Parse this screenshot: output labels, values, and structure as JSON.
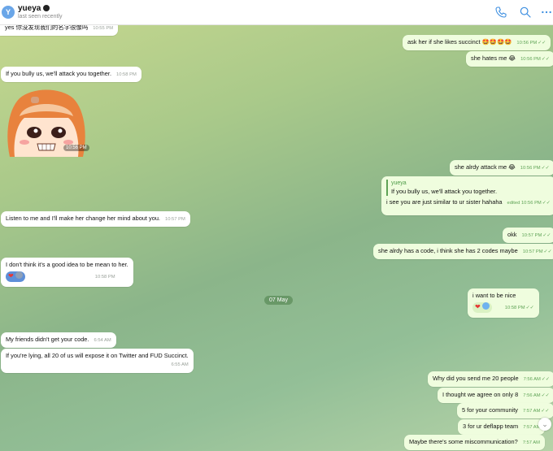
{
  "header": {
    "avatar_letter": "Y",
    "name": "yueya",
    "status": "last seen recently",
    "icons": [
      "phone-icon",
      "search-icon",
      "more-icon"
    ]
  },
  "messages": {
    "m0": {
      "text": "yes 你没发现我们的名字很像吗",
      "time": "10:55 PM"
    },
    "m1": {
      "text": "ask her if she likes succinct 🤩🤩🤩🤩",
      "time": "10:56 PM"
    },
    "m2": {
      "text": "she hates me 😂",
      "time": "10:56 PM"
    },
    "m3": {
      "text": "If you bully us, we'll attack you together.",
      "time": "10:58 PM"
    },
    "sticker_time": "10:56 PM",
    "m4": {
      "text": "she alrdy attack me 😂",
      "time": "10:56 PM"
    },
    "m5": {
      "reply_name": "yueya",
      "reply_text": "If you bully us, we'll attack you together.",
      "text": "i see you are just similar to ur sister hahaha",
      "time": "edited 10:56 PM"
    },
    "m6": {
      "text": "Listen to me and I'll make her change her mind about you.",
      "time": "10:57 PM"
    },
    "m7": {
      "text": "okk",
      "time": "10:57 PM"
    },
    "m8": {
      "text": "she alrdy has a code, i think she has 2 codes maybe",
      "time": "10:57 PM"
    },
    "m9": {
      "text": "I don't think it's a good idea to be mean to her.",
      "time": "10:58 PM"
    },
    "m10": {
      "text": "i want to be nice",
      "time": "10:58 PM"
    },
    "date_label": "07 May",
    "m11": {
      "text": "My friends didn't get your code.",
      "time": "6:54 AM"
    },
    "m12": {
      "text": "If you're lying, all 20 of us will expose it on Twitter and FUD Succinct.",
      "time": "6:55 AM"
    },
    "m13": {
      "text": "Why did you send me 20 people",
      "time": "7:56 AM"
    },
    "m14": {
      "text": "I thought we agree on only 8",
      "time": "7:56 AM"
    },
    "m15": {
      "text": "5 for your community",
      "time": "7:57 AM"
    },
    "m16": {
      "text": "3 for ur deflapp team",
      "time": "7:57 AM"
    },
    "m17": {
      "text": "Maybe there's some miscommunication?",
      "time": "7:57 AM"
    }
  },
  "colors": {
    "incoming": "#ffffff",
    "outgoing": "#effdde",
    "accent": "#5fa356",
    "header_icons": "#3a8de0"
  }
}
